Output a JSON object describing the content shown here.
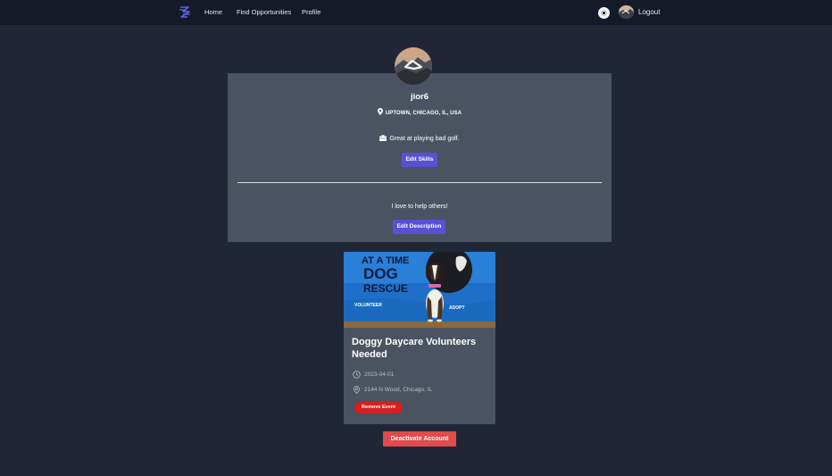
{
  "nav": {
    "logo_icon": "brand-logo-icon",
    "links": [
      "Home",
      "Find Opportunities",
      "Profile"
    ],
    "theme_toggle_icon": "sun-icon",
    "logout_label": "Logout"
  },
  "profile": {
    "username": "jior6",
    "location": "UPTOWN, CHICAGO, IL, USA",
    "skills": "Great at playing bad golf.",
    "edit_skills_label": "Edit Skills",
    "description": "I love to help others!",
    "edit_description_label": "Edit Description"
  },
  "event": {
    "image_text_line1": "AT A TIME",
    "image_text_line2": "DOG",
    "image_text_line3": "RESCUE",
    "image_banner_left": "VOLUNTEER",
    "image_banner_right": "ADOPT",
    "title": "Doggy Daycare Volunteers Needed",
    "date": "2023-04-01",
    "address": "2144 N Wood, Chicago, IL",
    "remove_label": "Remove Event"
  },
  "deactivate_label": "Deactivate Account",
  "colors": {
    "background": "#202635",
    "navbar": "#151a29",
    "card": "#4b5261",
    "primary": "#5b4fd6",
    "danger": "#d61f1f",
    "deactivate": "#e04b4b"
  }
}
